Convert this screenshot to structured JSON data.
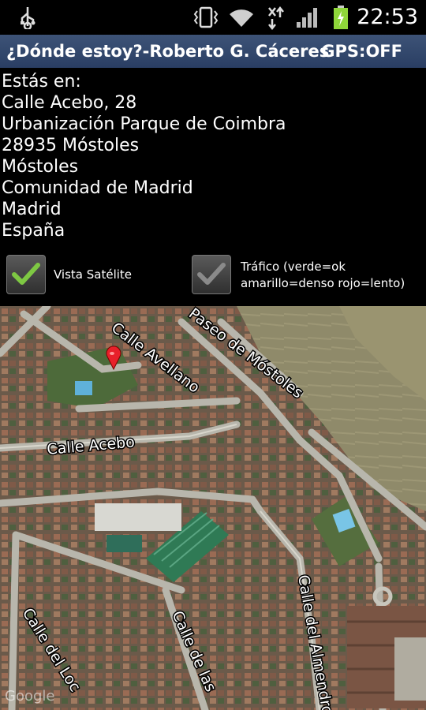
{
  "status": {
    "usb_icon": "usb-icon",
    "vibrate_icon": "vibrate-icon",
    "wifi_icon": "wifi-icon",
    "data_icon": "mobile-data-icon",
    "signal_icon": "signal-icon",
    "battery_icon": "battery-icon",
    "time": "22:53"
  },
  "header": {
    "title": "¿Dónde estoy?-Roberto G. Cáceres",
    "gps": "GPS:OFF",
    "bg_color": "#33486d"
  },
  "address": {
    "intro": "Estás en:",
    "lines": [
      "Calle Acebo, 28",
      "Urbanización Parque de Coimbra",
      "28935 Móstoles",
      "Móstoles",
      "Comunidad de Madrid",
      "Madrid",
      "España"
    ]
  },
  "options": {
    "satellite": {
      "label": "Vista Satélite",
      "checked": true
    },
    "traffic": {
      "label_line1": "Tráfico (verde=ok",
      "label_line2": "amarillo=denso rojo=lento)",
      "checked": false
    }
  },
  "map": {
    "streets": {
      "avellano": "Calle Avellano",
      "mostoles": "Paseo de Móstoles",
      "acebo": "Calle Acebo",
      "almendro": "Calle del Almendro",
      "de_las": "Calle de las",
      "del_loc": "Calle del Loc"
    },
    "watermark": "Google",
    "marker_color": "#e8202a",
    "check_color": "#7ec843"
  }
}
